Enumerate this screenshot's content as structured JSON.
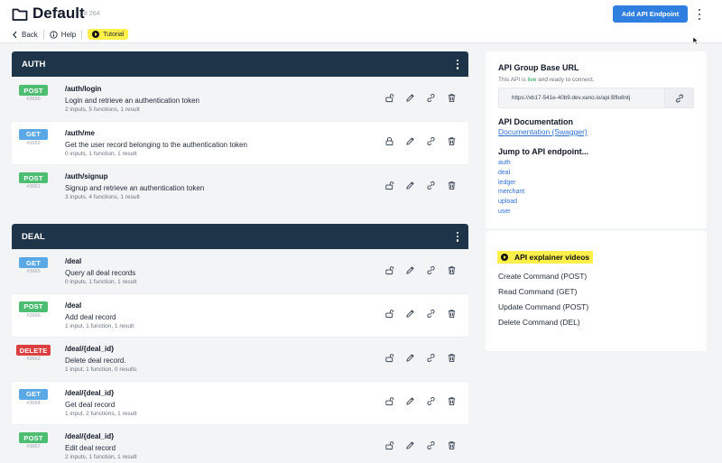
{
  "header": {
    "title": "Default",
    "id": "# 264",
    "add_button": "Add API Endpoint"
  },
  "nav": {
    "back": "Back",
    "help": "Help",
    "tutorial": "Tutorial"
  },
  "colors": {
    "post": "#4dbd73",
    "get": "#5aa8e6",
    "delete": "#dc3f3f",
    "header_bg": "#1e3449",
    "accent": "#2f7fe0"
  },
  "groups": [
    {
      "name": "AUTH",
      "endpoints": [
        {
          "method": "POST",
          "id": "#3650",
          "path": "/auth/login",
          "desc": "Login and retrieve an authentication token",
          "meta": "2 inputs, 5 functions, 1 result",
          "lock": "open"
        },
        {
          "method": "GET",
          "id": "#3652",
          "path": "/auth/me",
          "desc": "Get the user record belonging to the authentication token",
          "meta": "0 inputs, 1 function, 1 result",
          "lock": "closed"
        },
        {
          "method": "POST",
          "id": "#3651",
          "path": "/auth/signup",
          "desc": "Signup and retrieve an authentication token",
          "meta": "3 inputs, 4 functions, 1 result",
          "lock": "open"
        }
      ]
    },
    {
      "name": "DEAL",
      "endpoints": [
        {
          "method": "GET",
          "id": "#3665",
          "path": "/deal",
          "desc": "Query all deal records",
          "meta": "0 inputs, 1 function, 1 result",
          "lock": "open"
        },
        {
          "method": "POST",
          "id": "#3666",
          "path": "/deal",
          "desc": "Add deal record",
          "meta": "1 input, 1 function, 1 result",
          "lock": "open"
        },
        {
          "method": "DELETE",
          "id": "#3663",
          "path": "/deal/{deal_id}",
          "desc": "Delete deal record.",
          "meta": "1 input, 1 function, 0 results",
          "lock": "open"
        },
        {
          "method": "GET",
          "id": "#3664",
          "path": "/deal/{deal_id}",
          "desc": "Get deal record",
          "meta": "1 input, 2 functions, 1 result",
          "lock": "open"
        },
        {
          "method": "POST",
          "id": "#3667",
          "path": "/deal/{deal_id}",
          "desc": "Edit deal record",
          "meta": "2 inputs, 1 function, 1 result",
          "lock": "open"
        }
      ]
    }
  ],
  "sidebar": {
    "base_url_title": "API Group Base URL",
    "live_prefix": "This API is ",
    "live_word": "live",
    "live_suffix": " and ready to connect.",
    "base_url": "https://xb17-541e-40b9.dev.xano.io/api:Bflo8ntj",
    "docs_title": "API Documentation",
    "docs_link": "Documentation (Swagger)",
    "jump_title": "Jump to API endpoint...",
    "jump_links": [
      "auth",
      "deal",
      "ledger",
      "merchant",
      "upload",
      "user"
    ],
    "videos_title": "API explainer videos",
    "videos": [
      "Create Command (POST)",
      "Read Command (GET)",
      "Update Command (POST)",
      "Delete Command (DEL)"
    ]
  }
}
